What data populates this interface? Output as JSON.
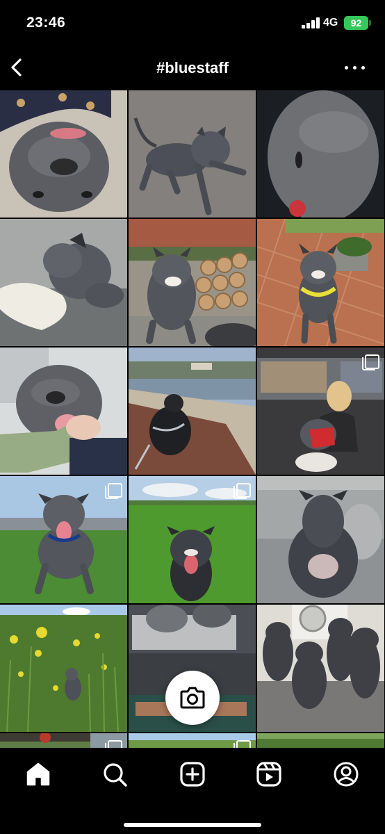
{
  "status": {
    "time": "23:46",
    "network": "4G",
    "battery": "92"
  },
  "header": {
    "title": "#bluestaff"
  },
  "grid": {
    "tiles": [
      {
        "subject": "dog-upside-down",
        "multi": false
      },
      {
        "subject": "dog-lying-carpet",
        "multi": false
      },
      {
        "subject": "dog-closeup",
        "multi": false
      },
      {
        "subject": "puppy-chewing-toy",
        "multi": false
      },
      {
        "subject": "dog-by-logs",
        "multi": false
      },
      {
        "subject": "dog-on-patio",
        "multi": false
      },
      {
        "subject": "dog-smiling-hand",
        "multi": false
      },
      {
        "subject": "dog-on-beach",
        "multi": false
      },
      {
        "subject": "woman-with-dog",
        "multi": true
      },
      {
        "subject": "dog-on-grass",
        "multi": true
      },
      {
        "subject": "dog-in-field",
        "multi": true
      },
      {
        "subject": "dog-on-sofa",
        "multi": false
      },
      {
        "subject": "dog-in-rapeseed",
        "multi": false
      },
      {
        "subject": "dogs-on-bed",
        "multi": false
      },
      {
        "subject": "four-dogs",
        "multi": false
      },
      {
        "subject": "partial-1",
        "multi": true
      },
      {
        "subject": "partial-2",
        "multi": true
      },
      {
        "subject": "partial-3",
        "multi": false
      }
    ]
  },
  "nav": {
    "items": [
      "home-icon",
      "search-icon",
      "create-icon",
      "reels-icon",
      "profile-icon"
    ]
  },
  "colors": {
    "accent": "#ffffff",
    "battery": "#35c759",
    "background": "#000000"
  }
}
